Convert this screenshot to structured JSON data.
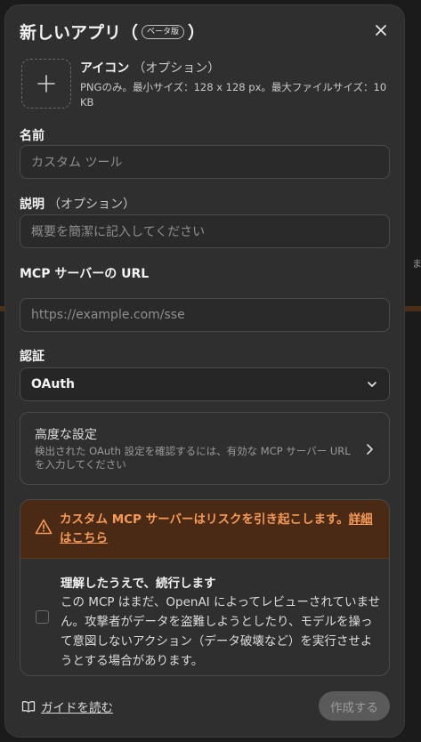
{
  "dialog": {
    "title": "新しいアプリ（",
    "title_end": "）",
    "beta_label": "ベータ版"
  },
  "icon_section": {
    "title": "アイコン",
    "optional": "（オプション）",
    "hint": "PNGのみ。最小サイズ：128 x 128 px。最大ファイルサイズ：10 KB"
  },
  "name_field": {
    "label": "名前",
    "placeholder": "カスタム ツール"
  },
  "description_field": {
    "label": "説明",
    "optional": "（オプション）",
    "placeholder": "概要を簡潔に記入してください"
  },
  "url_field": {
    "label": "MCP サーバーの URL",
    "placeholder": "https://example.com/sse"
  },
  "auth_field": {
    "label": "認証",
    "selected": "OAuth"
  },
  "advanced": {
    "title": "高度な設定",
    "description": "検出された OAuth 設定を確認するには、有効な MCP サーバー URL を入力してください"
  },
  "risk": {
    "warning": "カスタム MCP サーバーはリスクを引き起こします。",
    "link": "詳細はこちら",
    "ack_title": "理解したうえで、続行します",
    "ack_text": "この MCP はまだ、OpenAI によってレビューされていません。攻撃者がデータを盗難しようとしたり、モデルを操って意図しないアクション（データ破壊など）を実行させようとする場合があります。",
    "checked": false
  },
  "footer": {
    "guide_label": "ガイドを読む",
    "create_label": "作成する"
  },
  "background": {
    "peek_text": "まで"
  },
  "colors": {
    "warning": "#f59a5a",
    "warning_bg": "#4a2a14"
  }
}
